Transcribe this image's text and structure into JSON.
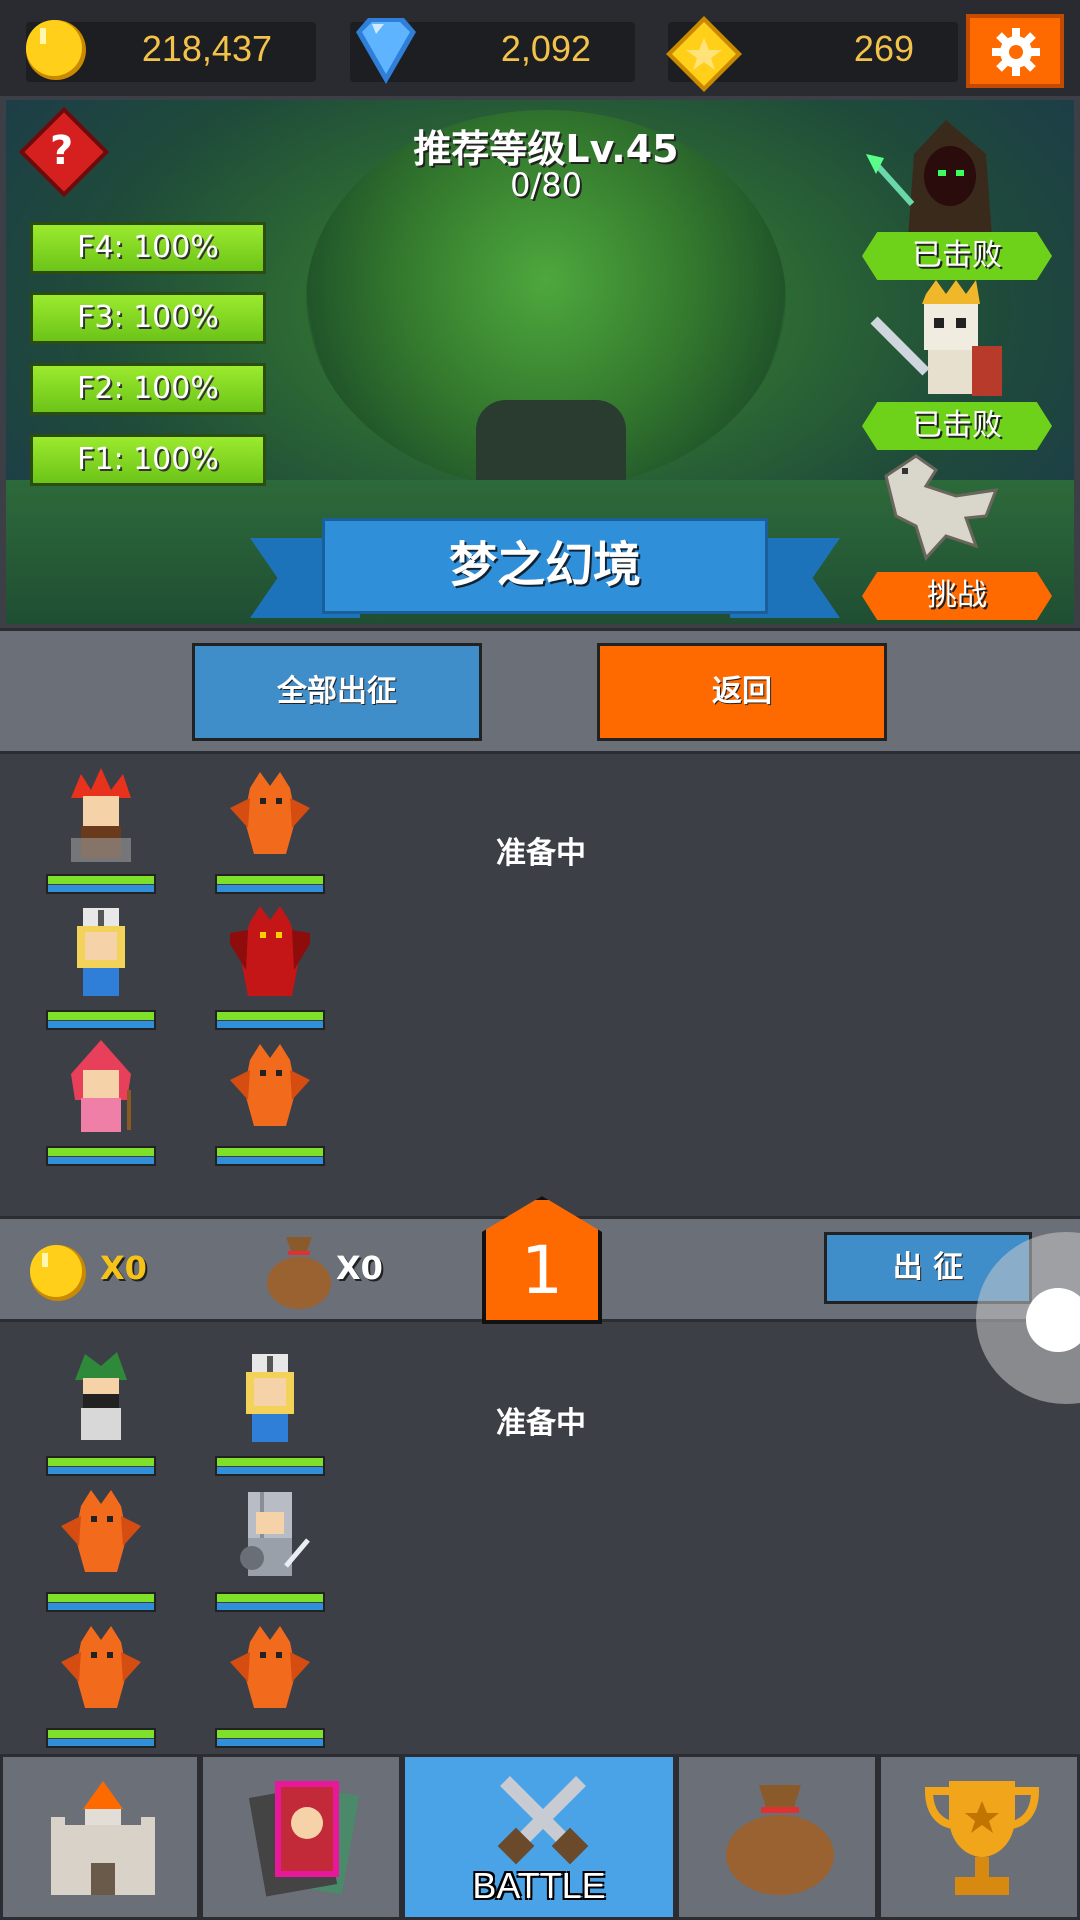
{
  "currency": {
    "coins": "218,437",
    "gems": "2,092",
    "stars": "269"
  },
  "stage": {
    "title": "推荐等级Lv.45",
    "progress": "0/80",
    "name": "梦之幻境",
    "floors": [
      "F4: 100%",
      "F3: 100%",
      "F2: 100%",
      "F1: 100%"
    ],
    "bosses": [
      {
        "icon": "hooded-mage-boss-icon",
        "status": "已击败"
      },
      {
        "icon": "skeleton-king-boss-icon",
        "status": "已击败"
      },
      {
        "icon": "bone-dragon-boss-icon",
        "status": "挑战"
      }
    ]
  },
  "actions": {
    "deploy_all": "全部出征",
    "back": "返回"
  },
  "squad1": {
    "status": "准备中",
    "units": [
      "red-hair-warrior",
      "orange-dragon",
      "blonde-cleric",
      "red-dragon",
      "red-hood-mage",
      "orange-dragon"
    ]
  },
  "squad_bar": {
    "coin_count": "X0",
    "bag_count": "X0",
    "squad_number": "1",
    "deploy": "出 征"
  },
  "squad2": {
    "status": "准备中",
    "units": [
      "green-hair-rogue",
      "blonde-cleric",
      "orange-dragon",
      "armored-knight",
      "orange-dragon",
      "orange-dragon"
    ]
  },
  "nav": {
    "battle_label": "BATTLE"
  },
  "colors": {
    "accent_orange": "#ff6a00",
    "button_blue": "#3f8dc9",
    "gold": "#f3c24a",
    "hp_green": "#7fe02a"
  }
}
